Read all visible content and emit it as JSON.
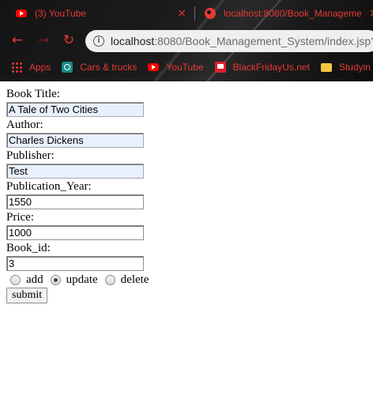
{
  "browser": {
    "tabs": [
      {
        "title": "(3) YouTube",
        "icon": "youtube-icon",
        "close": "×"
      },
      {
        "title": "localhost:8080/Book_Manageme",
        "icon": "globe-icon",
        "close": "×"
      }
    ],
    "nav": {
      "back": "←",
      "forward": "→",
      "reload": "↻"
    },
    "address": {
      "host": "localhost",
      "path": ":8080/Book_Management_System/index.jsp?",
      "info": "i"
    },
    "bookmarks": [
      {
        "label": "Apps",
        "icon": "apps-icon"
      },
      {
        "label": "Cars & trucks",
        "icon": "cars-icon"
      },
      {
        "label": "YouTube",
        "icon": "youtube-icon"
      },
      {
        "label": "BlackFridayUs.net",
        "icon": "blackfriday-icon"
      },
      {
        "label": "Studyin",
        "icon": "folder-icon"
      }
    ],
    "accent_color": "#e53935"
  },
  "form": {
    "fields": [
      {
        "label": "Book Title:",
        "value": "A Tale of Two Cities"
      },
      {
        "label": "Author:",
        "value": "Charles Dickens"
      },
      {
        "label": "Publisher:",
        "value": "Test"
      },
      {
        "label": "Publication_Year:",
        "value": "1550"
      },
      {
        "label": "Price:",
        "value": "1000"
      },
      {
        "label": "Book_id:",
        "value": "3"
      }
    ],
    "actions": [
      {
        "label": "add",
        "checked": false
      },
      {
        "label": "update",
        "checked": true
      },
      {
        "label": "delete",
        "checked": false
      }
    ],
    "submit_label": "submit"
  }
}
